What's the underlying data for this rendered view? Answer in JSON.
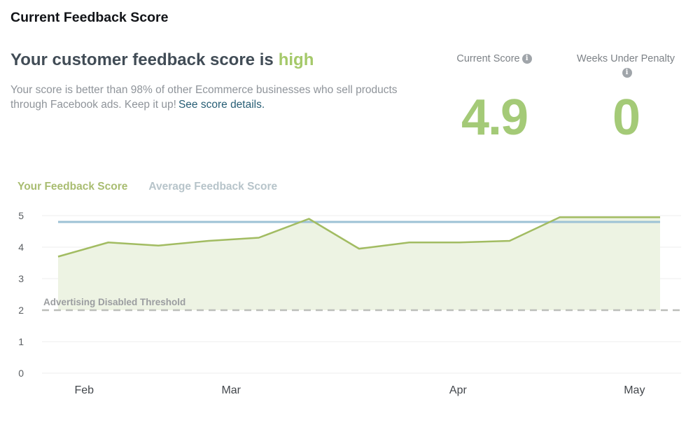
{
  "page": {
    "title": "Current Feedback Score"
  },
  "summary": {
    "heading_prefix": "Your customer feedback score is",
    "heading_status": "high",
    "status_color": "#a5c96a",
    "description": "Your score is better than 98% of other Ecommerce businesses who sell products through Facebook ads. Keep it up!",
    "link_label": "See score details.",
    "link_color": "#275e75"
  },
  "stats": [
    {
      "label": "Current Score",
      "value": "4.9",
      "icon": "info-icon",
      "icon_glyph": "i",
      "value_color": "#a4ca77"
    },
    {
      "label": "Weeks Under Penalty",
      "value": "0",
      "icon": "info-icon",
      "icon_glyph": "i",
      "value_color": "#a4ca77"
    }
  ],
  "legend": [
    {
      "label": "Your Feedback Score",
      "color": "#a9bd72"
    },
    {
      "label": "Average Feedback Score",
      "color": "#b7c4ca"
    }
  ],
  "chart_data": {
    "type": "line",
    "title": "",
    "xlabel": "",
    "ylabel": "",
    "x_unit": "week",
    "x": [
      1,
      2,
      3,
      4,
      5,
      6,
      7,
      8,
      9,
      10,
      11,
      12,
      13
    ],
    "series": [
      {
        "name": "Your Feedback Score",
        "color": "#a2bc62",
        "fill_color": "#edf3e3",
        "fill_to_value": 2,
        "values": [
          3.7,
          4.15,
          4.05,
          4.2,
          4.3,
          4.9,
          3.95,
          4.15,
          4.15,
          4.2,
          4.95,
          4.95,
          4.95
        ]
      },
      {
        "name": "Average Feedback Score",
        "color": "#9dc2d5",
        "values": [
          4.8,
          4.8,
          4.8,
          4.8,
          4.8,
          4.8,
          4.8,
          4.8,
          4.8,
          4.8,
          4.8,
          4.8,
          4.8
        ]
      }
    ],
    "threshold": {
      "value": 2,
      "label": "Advertising Disabled Threshold",
      "line_color": "#bcbeba",
      "label_color": "#9b9da0",
      "style": "dashed"
    },
    "y_ticks": [
      0,
      1,
      2,
      3,
      4,
      5
    ],
    "ylim": [
      0,
      5
    ],
    "x_tick_labels": [
      {
        "label": "Feb",
        "frac": 0.066
      },
      {
        "label": "Mar",
        "frac": 0.296
      },
      {
        "label": "Apr",
        "frac": 0.651
      },
      {
        "label": "May",
        "frac": 0.927
      }
    ],
    "grid": "horizontal",
    "grid_color": "#ececec",
    "legend_position": "top-left"
  }
}
